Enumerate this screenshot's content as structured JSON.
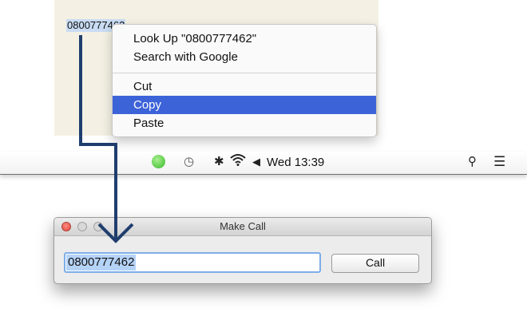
{
  "document": {
    "selected_text": "0800777462"
  },
  "context_menu": {
    "items": [
      {
        "label": "Look Up \"0800777462\""
      },
      {
        "label": "Search with Google"
      },
      {
        "label": "Cut"
      },
      {
        "label": "Copy",
        "highlighted": true
      },
      {
        "label": "Paste"
      }
    ]
  },
  "menubar": {
    "icons": [
      "phone-status-icon",
      "clock-icon",
      "bluetooth-icon",
      "wifi-icon",
      "volume-icon",
      "search-icon",
      "list-icon"
    ],
    "clock": "Wed 13:39"
  },
  "window": {
    "title": "Make Call",
    "phone_value": "0800777462",
    "call_label": "Call"
  },
  "colors": {
    "menu_highlight": "#3d63d9",
    "arrow": "#1f3e6e",
    "input_focus": "#7eaee8"
  }
}
